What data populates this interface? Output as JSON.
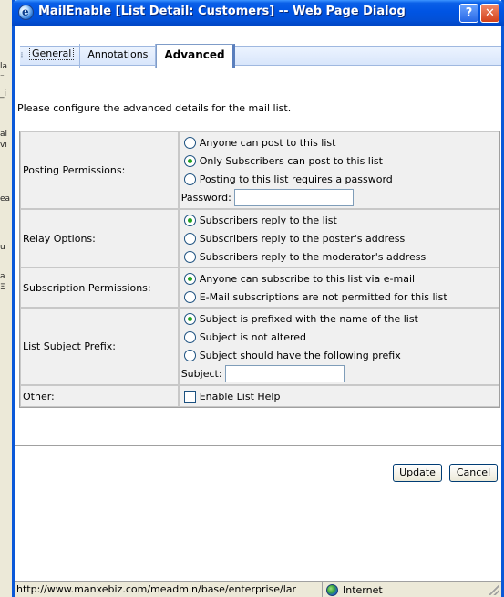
{
  "window": {
    "title": "MailEnable [List Detail: Customers] -- Web Page Dialog",
    "help_button": "?",
    "close_button": "✕"
  },
  "background_fragments": [
    "la",
    "⁻",
    "_i",
    "ai",
    "vi",
    "ea",
    "u",
    "a",
    "Ξ"
  ],
  "tabs": [
    {
      "label": "General",
      "active": false
    },
    {
      "label": "Annotations",
      "active": false
    },
    {
      "label": "Advanced",
      "active": true
    }
  ],
  "intro_text": "Please configure the advanced details for the mail list.",
  "sections": {
    "posting": {
      "label": "Posting Permissions:",
      "options": [
        {
          "label": "Anyone can post to this list",
          "checked": false
        },
        {
          "label": "Only Subscribers can post to this list",
          "checked": true
        },
        {
          "label": "Posting to this list requires a password",
          "checked": false
        }
      ],
      "password_label": "Password:",
      "password_value": ""
    },
    "relay": {
      "label": "Relay Options:",
      "options": [
        {
          "label": "Subscribers reply to the list",
          "checked": true
        },
        {
          "label": "Subscribers reply to the poster's address",
          "checked": false
        },
        {
          "label": "Subscribers reply to the moderator's address",
          "checked": false
        }
      ]
    },
    "subscription": {
      "label": "Subscription Permissions:",
      "options": [
        {
          "label": "Anyone can subscribe to this list via e-mail",
          "checked": true
        },
        {
          "label": "E-Mail subscriptions are not permitted for this list",
          "checked": false
        }
      ]
    },
    "subject_prefix": {
      "label": "List Subject Prefix:",
      "options": [
        {
          "label": "Subject is prefixed with the name of the list",
          "checked": true
        },
        {
          "label": "Subject is not altered",
          "checked": false
        },
        {
          "label": "Subject should have the following prefix",
          "checked": false
        }
      ],
      "subject_label": "Subject:",
      "subject_value": ""
    },
    "other": {
      "label": "Other:",
      "checkbox_label": "Enable List Help",
      "checked": false
    }
  },
  "buttons": {
    "update": "Update",
    "cancel": "Cancel"
  },
  "status_bar": {
    "url": "http://www.manxebiz.com/meadmin/base/enterprise/lar",
    "zone": "Internet"
  },
  "colors": {
    "titlebar": "#0054e3",
    "radio_checked": "#21a121",
    "table_bg": "#f0f0f0"
  }
}
